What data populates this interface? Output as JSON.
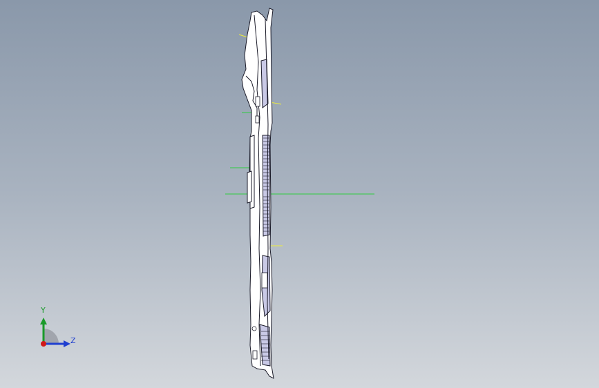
{
  "viewport": {
    "background_top": "#8a98aa",
    "background_bottom": "#d3d7dc"
  },
  "model": {
    "edge_color": "#1a1a28",
    "fill_color": "#ffffff",
    "shade_color": "#c9c9e6",
    "sketch_yellow": "#f0ee3a",
    "sketch_green": "#2ecc40"
  },
  "triad": {
    "y_label": "Y",
    "z_label": "Z",
    "y_color": "#1a9a2a",
    "z_color": "#1f3fd0",
    "origin_color": "#d01818",
    "icon": "coordinate-triad-icon"
  }
}
